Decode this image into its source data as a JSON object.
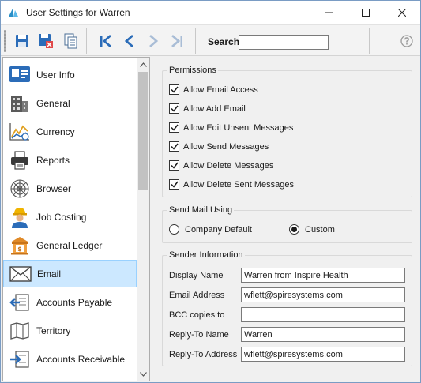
{
  "window": {
    "title": "User Settings for Warren",
    "accent": "#0078d7"
  },
  "toolbar": {
    "search_label": "Search",
    "search_value": "",
    "icons": [
      "save-icon",
      "save-close-icon",
      "copy-icon",
      "first-record-icon",
      "previous-record-icon",
      "next-record-icon",
      "last-record-icon",
      "help-icon"
    ]
  },
  "sidebar": {
    "items": [
      {
        "label": "User Info",
        "icon": "id-card-icon"
      },
      {
        "label": "General",
        "icon": "building-icon"
      },
      {
        "label": "Currency",
        "icon": "currency-chart-icon"
      },
      {
        "label": "Reports",
        "icon": "printer-icon"
      },
      {
        "label": "Browser",
        "icon": "web-icon"
      },
      {
        "label": "Job Costing",
        "icon": "worker-icon"
      },
      {
        "label": "General Ledger",
        "icon": "bank-icon"
      },
      {
        "label": "Email",
        "icon": "envelope-icon",
        "selected": true
      },
      {
        "label": "Accounts Payable",
        "icon": "payable-icon"
      },
      {
        "label": "Territory",
        "icon": "map-icon"
      },
      {
        "label": "Accounts Receivable",
        "icon": "receivable-icon"
      }
    ]
  },
  "permissions": {
    "title": "Permissions",
    "items": [
      {
        "label": "Allow Email Access",
        "checked": true
      },
      {
        "label": "Allow Add Email",
        "checked": true
      },
      {
        "label": "Allow Edit Unsent Messages",
        "checked": true
      },
      {
        "label": "Allow Send Messages",
        "checked": true
      },
      {
        "label": "Allow Delete Messages",
        "checked": true
      },
      {
        "label": "Allow Delete Sent Messages",
        "checked": true
      }
    ]
  },
  "send_mail": {
    "title": "Send Mail Using",
    "options": [
      {
        "label": "Company Default",
        "selected": false
      },
      {
        "label": "Custom",
        "selected": true
      }
    ]
  },
  "sender": {
    "title": "Sender Information",
    "fields": [
      {
        "label": "Display Name",
        "value": "Warren from Inspire Health"
      },
      {
        "label": "Email Address",
        "value": "wflett@spiresystems.com"
      },
      {
        "label": "BCC copies to",
        "value": ""
      },
      {
        "label": "Reply-To Name",
        "value": "Warren"
      },
      {
        "label": "Reply-To Address",
        "value": "wflett@spiresystems.com"
      }
    ]
  }
}
